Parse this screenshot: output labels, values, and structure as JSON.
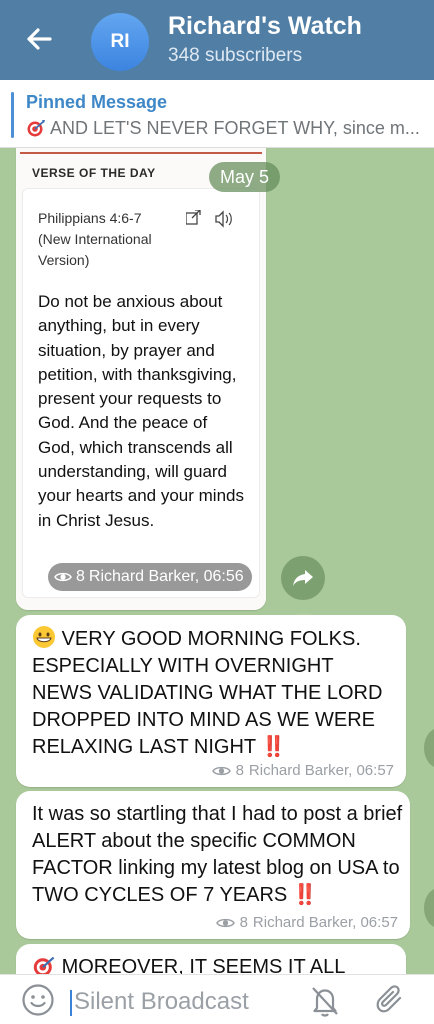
{
  "header": {
    "back_icon": "arrow-left-icon",
    "avatar_initials": "RI",
    "title": "Richard's Watch",
    "subtitle": "348 subscribers",
    "background": "#507ea4"
  },
  "pinned": {
    "title": "Pinned Message",
    "icon": "dart-target-icon",
    "text": "AND LET'S NEVER FORGET WHY, since m..."
  },
  "chat": {
    "date_pill": "May 5",
    "image_message": {
      "verse_heading": "VERSE OF THE DAY",
      "reference": "Philippians 4:6-7 (New International Version)",
      "verse_text": "Do not be anxious about anything, but in every situation, by prayer and petition, with thanksgiving, present your requests to God. And the peace of God, which transcends all understanding, will guard your hearts and your minds in Christ Jesus.",
      "views": "8",
      "author_time": "Richard Barker, 06:56"
    },
    "messages": [
      {
        "emoji": "grinning-face-icon",
        "text": "VERY GOOD MORNING FOLKS. ESPECIALLY WITH OVERNIGHT NEWS VALIDATING WHAT THE LORD DROPPED INTO MIND AS WE WERE RELAXING LAST NIGHT",
        "suffix": "‼️",
        "views": "8",
        "author_time": "Richard Barker, 06:57"
      },
      {
        "text": "It was so startling that I had to post a brief ALERT about the specific COMMON FACTOR linking my latest blog on USA to TWO CYCLES OF 7 YEARS",
        "suffix": "‼️",
        "views": "8",
        "author_time": "Richard Barker, 06:57"
      },
      {
        "emoji": "dart-target-icon",
        "text": "MOREOVER, IT SEEMS IT ALL"
      }
    ]
  },
  "input": {
    "placeholder": "Silent Broadcast",
    "emoji_icon": "smiley-icon",
    "silent_icon": "bell-off-icon",
    "attach_icon": "paperclip-icon"
  }
}
